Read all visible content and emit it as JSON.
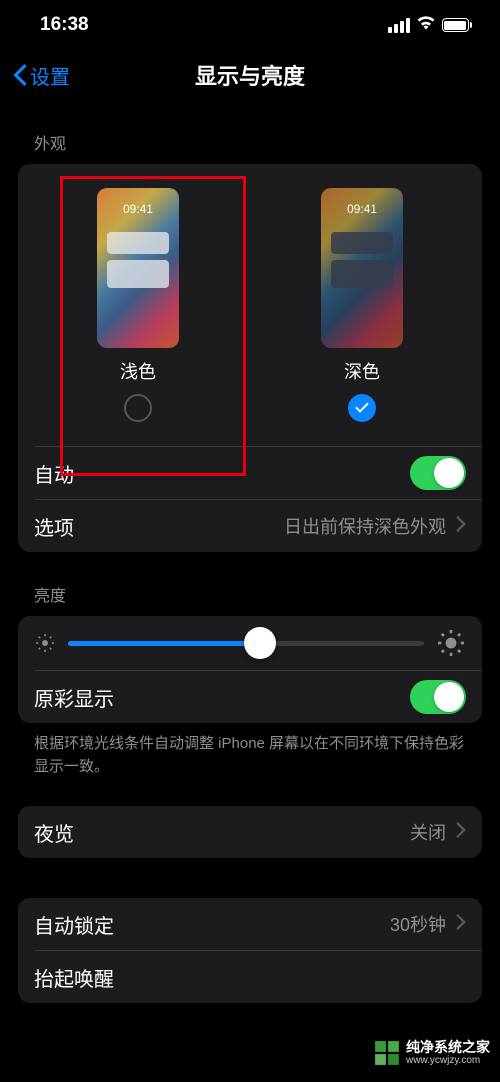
{
  "status_bar": {
    "time": "16:38"
  },
  "nav": {
    "back": "设置",
    "title": "显示与亮度"
  },
  "appearance": {
    "header": "外观",
    "preview_time": "09:41",
    "light_label": "浅色",
    "dark_label": "深色",
    "selected": "dark",
    "auto": {
      "label": "自动",
      "on": true
    },
    "options": {
      "label": "选项",
      "value": "日出前保持深色外观"
    }
  },
  "brightness": {
    "header": "亮度",
    "slider_percent": 54,
    "true_tone": {
      "label": "原彩显示",
      "on": true
    },
    "footnote": "根据环境光线条件自动调整 iPhone 屏幕以在不同环境下保持色彩显示一致。"
  },
  "night_shift": {
    "label": "夜览",
    "value": "关闭"
  },
  "auto_lock": {
    "label": "自动锁定",
    "value": "30秒钟"
  },
  "raise_to_wake": {
    "label": "抬起唤醒"
  },
  "watermark": {
    "title": "纯净系统之家",
    "url": "www.ycwjzy.com"
  }
}
